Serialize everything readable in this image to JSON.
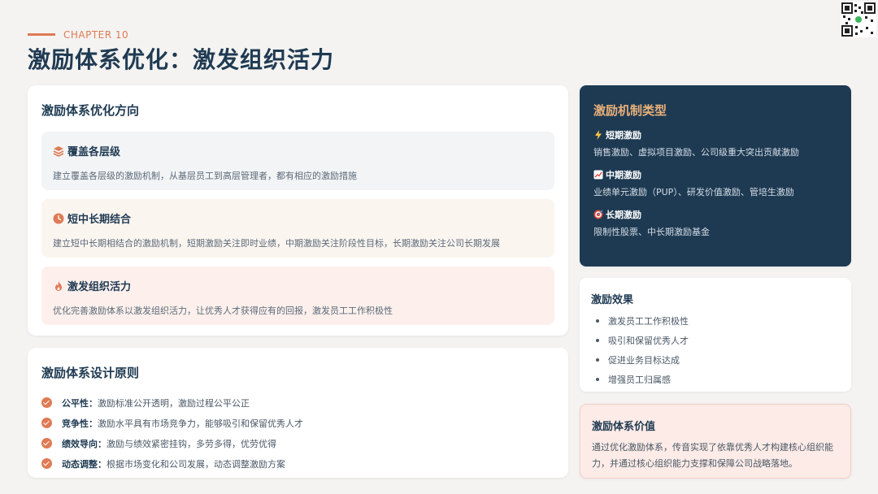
{
  "header": {
    "chapter": "CHAPTER 10",
    "title": "激励体系优化：激发组织活力"
  },
  "directions": {
    "title": "激励体系优化方向",
    "items": [
      {
        "icon": "layers-icon",
        "title": "覆盖各层级",
        "desc": "建立覆盖各层级的激励机制，从基层员工到高层管理者，都有相应的激励措施",
        "bg": "#f2f4f6"
      },
      {
        "icon": "clock-icon",
        "title": "短中长期结合",
        "desc": "建立短中长期相结合的激励机制，短期激励关注即时业绩，中期激励关注阶段性目标，长期激励关注公司长期发展",
        "bg": "#fbf5f0"
      },
      {
        "icon": "flame-icon",
        "title": "激发组织活力",
        "desc": "优化完善激励体系以激发组织活力，让优秀人才获得应有的回报，激发员工工作积极性",
        "bg": "#fdf0ec"
      }
    ]
  },
  "principles": {
    "title": "激励体系设计原则",
    "items": [
      {
        "label": "公平性：",
        "text": "激励标准公开透明，激励过程公平公正"
      },
      {
        "label": "竞争性：",
        "text": "激励水平具有市场竞争力，能够吸引和保留优秀人才"
      },
      {
        "label": "绩效导向：",
        "text": "激励与绩效紧密挂钩，多劳多得，优劳优得"
      },
      {
        "label": "动态调整：",
        "text": "根据市场变化和公司发展，动态调整激励方案"
      }
    ]
  },
  "mechanism": {
    "title": "激励机制类型",
    "items": [
      {
        "icon": "lightning-icon",
        "title": "短期激励",
        "desc": "销售激励、虚拟项目激励、公司级重大突出贡献激励"
      },
      {
        "icon": "chart-up-icon",
        "title": "中期激励",
        "desc": "业绩单元激励（PUP）、研发价值激励、管培生激励"
      },
      {
        "icon": "target-icon",
        "title": "长期激励",
        "desc": "限制性股票、中长期激励基金"
      }
    ]
  },
  "effects": {
    "title": "激励效果",
    "items": [
      "激发员工工作积极性",
      "吸引和保留优秀人才",
      "促进业务目标达成",
      "增强员工归属感"
    ]
  },
  "value": {
    "title": "激励体系价值",
    "text": "通过优化激励体系，传音实现了依靠优秀人才构建核心组织能力，并通过核心组织能力支撑和保障公司战略落地。"
  },
  "colors": {
    "accent": "#e07a55",
    "navy": "#1e3a52",
    "gold": "#e8b07a"
  }
}
